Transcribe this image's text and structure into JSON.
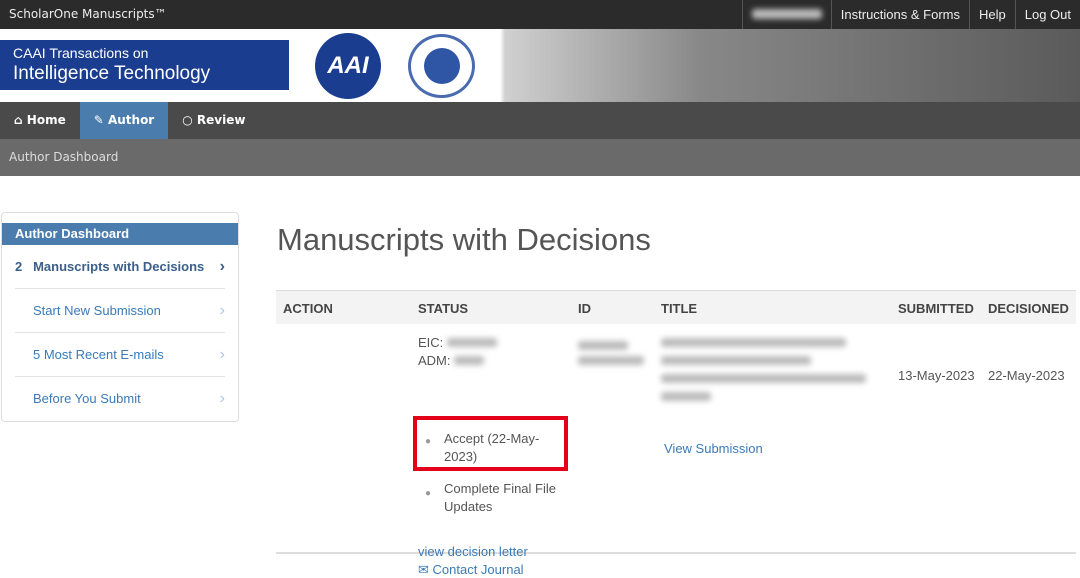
{
  "topbar": {
    "brand": "ScholarOne Manuscripts™",
    "links": [
      "Instructions & Forms",
      "Help",
      "Log Out"
    ]
  },
  "banner": {
    "line1": "CAAI Transactions on",
    "line2": "Intelligence Technology",
    "logo_text": "AAI"
  },
  "nav": {
    "items": [
      "Home",
      "Author",
      "Review"
    ],
    "active": "Author"
  },
  "breadcrumb": "Author Dashboard",
  "sidebar": {
    "title": "Author Dashboard",
    "items": [
      {
        "count": "2",
        "label": "Manuscripts with Decisions"
      },
      {
        "label": "Start New Submission"
      },
      {
        "label": "5 Most Recent E-mails"
      },
      {
        "label": "Before You Submit"
      }
    ]
  },
  "main": {
    "title": "Manuscripts with Decisions",
    "columns": [
      "ACTION",
      "STATUS",
      "ID",
      "TITLE",
      "SUBMITTED",
      "DECISIONED"
    ],
    "row": {
      "eic_label": "EIC:",
      "adm_label": "ADM:",
      "status_items": [
        "Accept (22-May-2023)",
        "Complete Final File Updates"
      ],
      "view_decision": "view decision letter",
      "contact": "Contact Journal",
      "view_submission": "View Submission",
      "submitted": "13-May-2023",
      "decisioned": "22-May-2023"
    }
  },
  "colors": {
    "accent": "#4a7dad",
    "link": "#3a7ab8",
    "highlight": "#e4001b",
    "brand_blue": "#1b3d8f"
  }
}
